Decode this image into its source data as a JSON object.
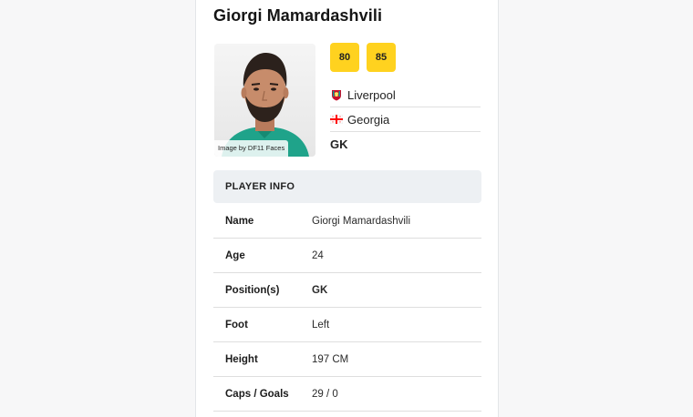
{
  "player": {
    "name": "Giorgi Mamardashvili",
    "photo_credit": "Image by DF11 Faces",
    "ratings": [
      "80",
      "85"
    ],
    "club": "Liverpool",
    "nation": "Georgia",
    "position": "GK",
    "icons": {
      "club": "liverpool-crest-icon",
      "nation": "georgia-flag-icon"
    }
  },
  "info": {
    "header": "PLAYER INFO",
    "rows": [
      {
        "label": "Name",
        "value": "Giorgi Mamardashvili"
      },
      {
        "label": "Age",
        "value": "24"
      },
      {
        "label": "Position(s)",
        "value": "GK"
      },
      {
        "label": "Foot",
        "value": "Left"
      },
      {
        "label": "Height",
        "value": "197 CM"
      },
      {
        "label": "Caps / Goals",
        "value": "29 / 0"
      }
    ]
  },
  "colors": {
    "rating_badge": "#ffd21f",
    "info_header_bg": "#edf0f3",
    "club_red": "#c8102e",
    "georgia_red": "#ff0000"
  }
}
